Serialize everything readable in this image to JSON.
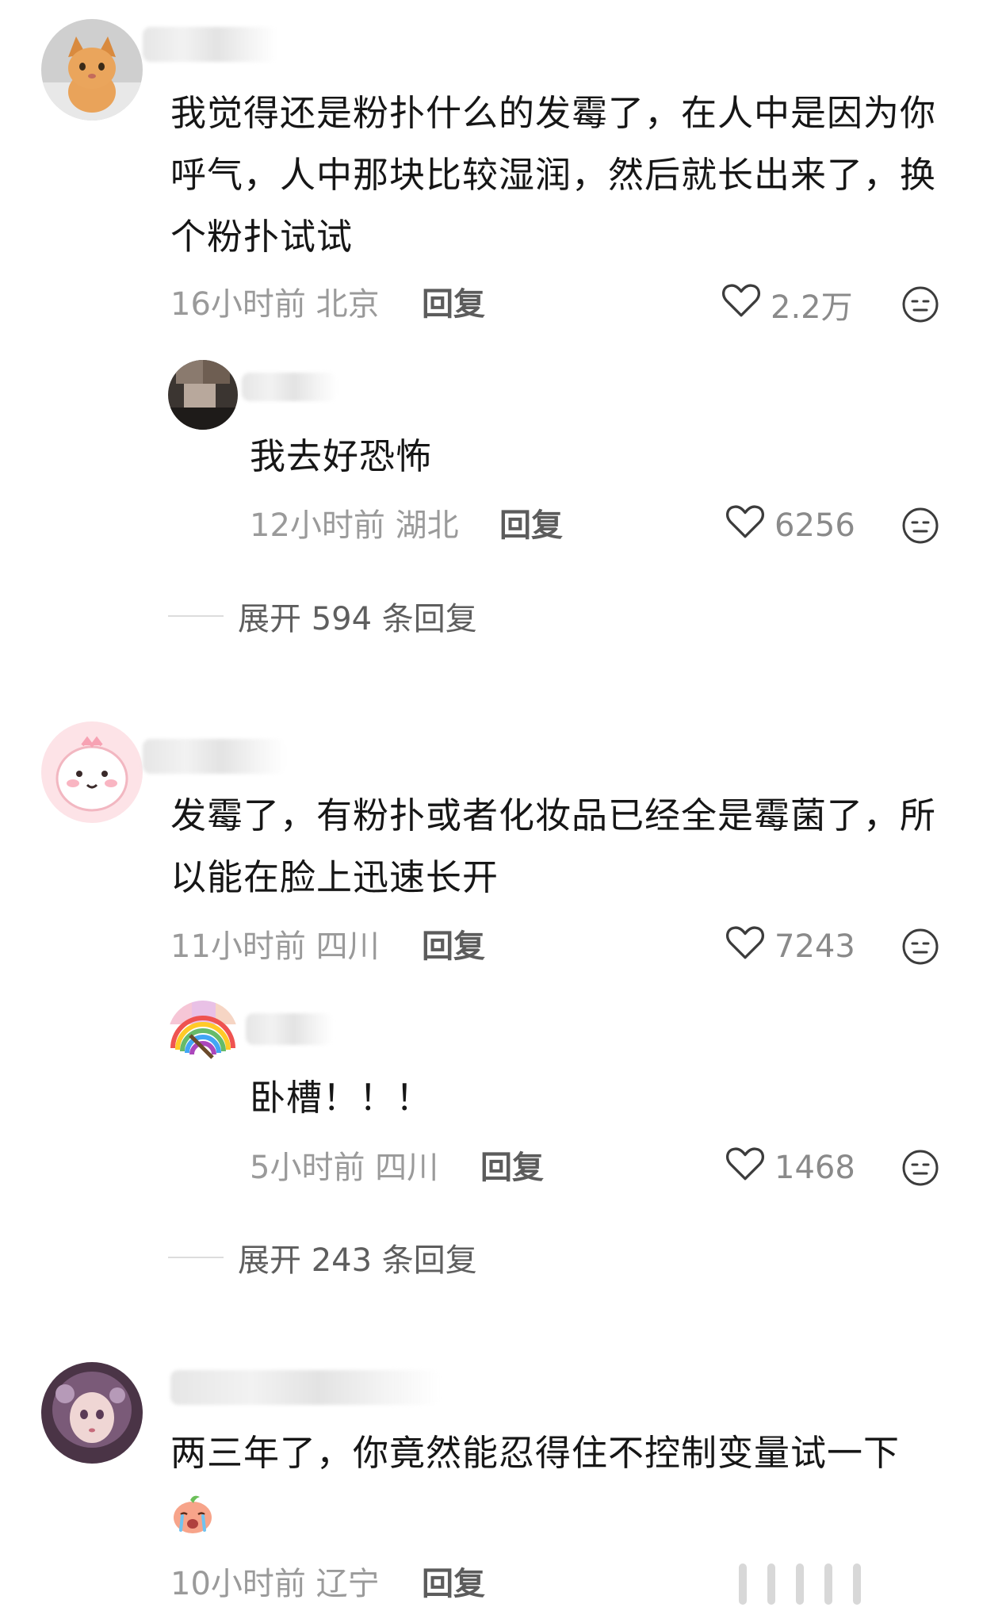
{
  "comments": [
    {
      "text": "我觉得还是粉扑什么的发霉了，在人中是因为你呼气，人中那块比较湿润，然后就长出来了，换个粉扑试试",
      "time_location": "16小时前 北京",
      "reply_label": "回复",
      "likes": "2.2万",
      "sub_reply": {
        "text": "我去好恐怖",
        "time_location": "12小时前 湖北",
        "reply_label": "回复",
        "likes": "6256"
      },
      "expand_label": "展开 594 条回复"
    },
    {
      "text": "发霉了，有粉扑或者化妆品已经全是霉菌了，所以能在脸上迅速长开",
      "time_location": "11小时前 四川",
      "reply_label": "回复",
      "likes": "7243",
      "sub_reply": {
        "text": "卧槽！！！",
        "time_location": "5小时前 四川",
        "reply_label": "回复",
        "likes": "1468"
      },
      "expand_label": "展开 243 条回复"
    },
    {
      "text": "两三年了，你竟然能忍得住不控制变量试一下",
      "time_location": "10小时前 辽宁",
      "reply_label": "回复"
    }
  ],
  "icons": {
    "like": "heart-outline-icon",
    "dislike": "meh-face-icon",
    "sticker": "crying-peach-sticker"
  },
  "colors": {
    "text": "#161616",
    "meta": "#9a9a9a",
    "reply": "#5c5c5c",
    "divider": "#dcdcdc"
  }
}
